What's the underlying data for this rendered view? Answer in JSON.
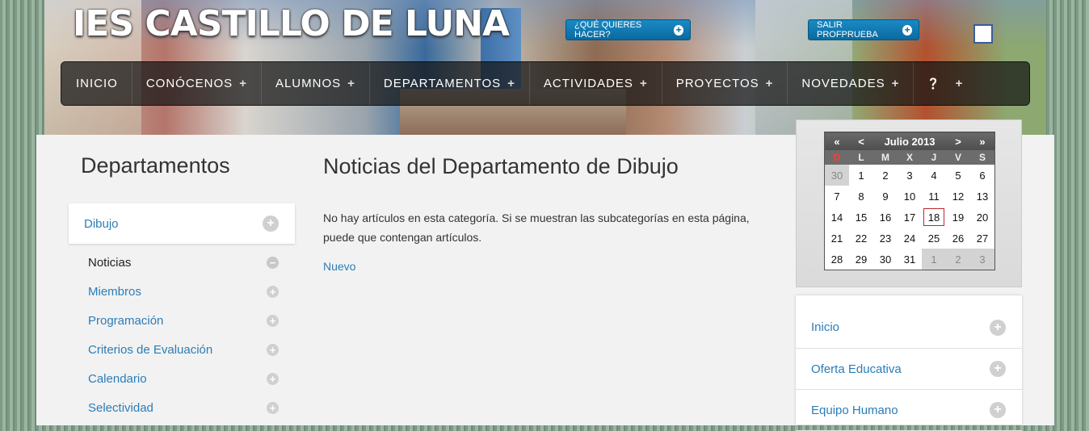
{
  "header": {
    "site_title": "IES CASTILLO DE LUNA",
    "buttons": [
      {
        "label": "¿QUÉ QUIERES HACER?"
      },
      {
        "label": "SALIR PROFPRUEBA"
      }
    ]
  },
  "nav": {
    "items": [
      {
        "label": "INICIO"
      },
      {
        "label": "CONÓCENOS"
      },
      {
        "label": "ALUMNOS"
      },
      {
        "label": "DEPARTAMENTOS"
      },
      {
        "label": "ACTIVIDADES"
      },
      {
        "label": "PROYECTOS"
      },
      {
        "label": "NOVEDADES"
      }
    ],
    "plus": "+",
    "help": "❓"
  },
  "sidebar": {
    "heading": "Departamentos",
    "current": "Dibujo",
    "items": [
      {
        "label": "Noticias"
      },
      {
        "label": "Miembros"
      },
      {
        "label": "Programación"
      },
      {
        "label": "Criterios de Evaluación"
      },
      {
        "label": "Calendario"
      },
      {
        "label": "Selectividad"
      }
    ]
  },
  "main": {
    "title": "Noticias del Departamento de Dibujo",
    "text": "No hay artículos en esta categoría. Si se muestran las subcategorías en esta página, puede que contengan artículos.",
    "new_link": "Nuevo"
  },
  "calendar": {
    "prev_year": "«",
    "prev_month": "<",
    "month": "Julio 2013",
    "next_month": ">",
    "next_year": "»",
    "days": [
      "D",
      "L",
      "M",
      "X",
      "J",
      "V",
      "S"
    ],
    "weeks": [
      [
        "30",
        "1",
        "2",
        "3",
        "4",
        "5",
        "6"
      ],
      [
        "7",
        "8",
        "9",
        "10",
        "11",
        "12",
        "13"
      ],
      [
        "14",
        "15",
        "16",
        "17",
        "18",
        "19",
        "20"
      ],
      [
        "21",
        "22",
        "23",
        "24",
        "25",
        "26",
        "27"
      ],
      [
        "28",
        "29",
        "30",
        "31",
        "1",
        "2",
        "3"
      ]
    ],
    "today": "18"
  },
  "right_menu": {
    "items": [
      {
        "label": "Inicio"
      },
      {
        "label": "Oferta Educativa"
      },
      {
        "label": "Equipo Humano"
      }
    ]
  },
  "colors": {
    "accent": "#2a7db8",
    "button_blue": "#0a6aa0",
    "today_outline": "#c0262c"
  }
}
